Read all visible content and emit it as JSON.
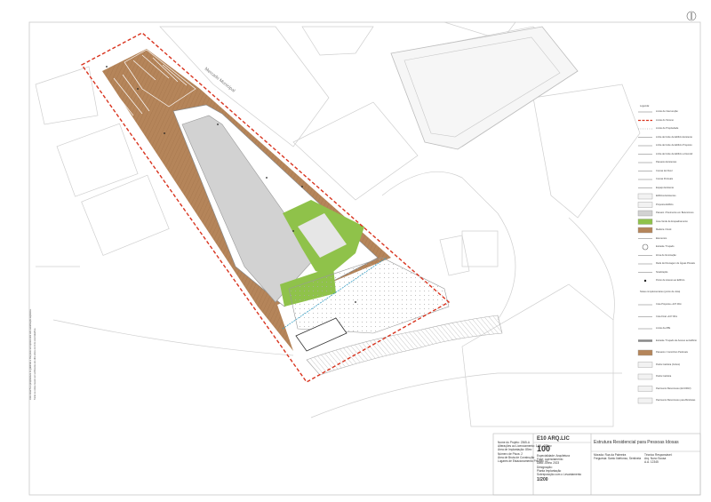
{
  "street_label": "Mercado Municipal",
  "north_symbol": "N",
  "colors": {
    "wood_deck": "#b5855a",
    "building_roof": "#d2d2d2",
    "green": "#8fc24a",
    "boundary_red": "#d9341f",
    "blue_line": "#3aa1c7",
    "plan_lines": "#c8c8c8"
  },
  "legend": {
    "title": "Legenda:",
    "items": [
      {
        "label": "Limite de Intervenção",
        "swatch": "line-grey"
      },
      {
        "label": "Limite do Terreno",
        "swatch": "line-red"
      },
      {
        "label": "Limite de Propriedade",
        "swatch": "line-dots"
      },
      {
        "label": "Linha de limite de Edifício Existente",
        "swatch": "line-grey"
      },
      {
        "label": "Linha de limite de Edifício Proposto",
        "swatch": "line-grey"
      },
      {
        "label": "Linha de limite de Edifício a Demolir",
        "swatch": "line-grey"
      },
      {
        "label": "Passeios Existentes",
        "swatch": "line-grey"
      },
      {
        "label": "Curvas de Nível",
        "swatch": "line-grey"
      },
      {
        "label": "Curvas Pontuais",
        "swatch": "line-grey"
      },
      {
        "label": "Espaço Existente",
        "swatch": "line-grey"
      },
      {
        "label": "Edifícios Existentes",
        "swatch": "box-light"
      },
      {
        "label": "Proposta Edifício",
        "swatch": "box-light"
      },
      {
        "label": "Passeio / Pavimento em Betuminoso",
        "swatch": "box-grey"
      },
      {
        "label": "Área Verde de Enquadramento",
        "swatch": "box-green"
      },
      {
        "label": "Madeira / Deck",
        "swatch": "box-wood"
      },
      {
        "label": "Elementos",
        "swatch": "line-grey"
      },
      {
        "label": "Estrada / Traçado",
        "swatch": "circle"
      },
      {
        "label": "Zona de Iluminação",
        "swatch": "line-grey"
      },
      {
        "label": "Rede de Drenagem de Águas Pluviais",
        "swatch": "line-grey"
      },
      {
        "label": "Sinalização",
        "swatch": "line-grey"
      },
      {
        "label": "Ponto de Acesso ao Edifício",
        "swatch": "dot"
      }
    ],
    "note": "Notas complementares (ponto de vista)",
    "items2": [
      {
        "label": "Cota Proposta +107.00m",
        "swatch": "line-grey"
      },
      {
        "label": "Cota Final +107.00m",
        "swatch": "line-grey"
      },
      {
        "label": "Limite da ZPE",
        "swatch": "line-grey"
      },
      {
        "label": "Estrada / Traçado de Acesso ao Edifício",
        "swatch": "line-hatch"
      },
      {
        "label": "Passeios / Caminhos Pedonais",
        "swatch": "box-wood"
      },
      {
        "label": "Pedra Calcária (Cubos)",
        "swatch": "box-light"
      },
      {
        "label": "Pedra Calcária",
        "swatch": "box-light"
      },
      {
        "label": "Pavimento Betuminoso (ECOPAV)",
        "swatch": "box-light"
      },
      {
        "label": "Pavimento Betuminoso para Bicicletas",
        "swatch": "box-light"
      }
    ]
  },
  "title_block": {
    "left_lines": [
      "Nome do Projeto: 2365-A",
      "Alterações ao Licenciamento: 1:00 - 025m²",
      "Área de Implantação: 85m²",
      "Número de Pisos: 2",
      "Área de Bruta de Construção",
      "Lugares de Estacionamento Privado: 12"
    ],
    "company": "E10 ARQ.LIC",
    "sheet_number": "100",
    "phase_lines": [
      "Especialidade: Arquitetura",
      "Fase: Licenciamento",
      "Data: Junho 2023",
      "Designação:",
      "Planta Implantação",
      "Sobreposição com o Levantamento"
    ],
    "scale": "1/200",
    "project_title": "Estrutura Residencial para Pessoas Idosas",
    "location_lines": [
      "Morada: Rua da Palmeira",
      "Freguesia: Santo Ildefonso, Sentinela"
    ],
    "responsible_lines": [
      "Técnico Responsável:",
      "Arq. Nuno Sousa",
      "A.A. 12345"
    ]
  },
  "side_notes": {
    "left": "Este desenho é propriedade do gabinete e não pode ser reproduzido sem autorização expressa.",
    "left2": "Todas as cotas devem ser verificadas em obra antes do início dos trabalhos."
  }
}
